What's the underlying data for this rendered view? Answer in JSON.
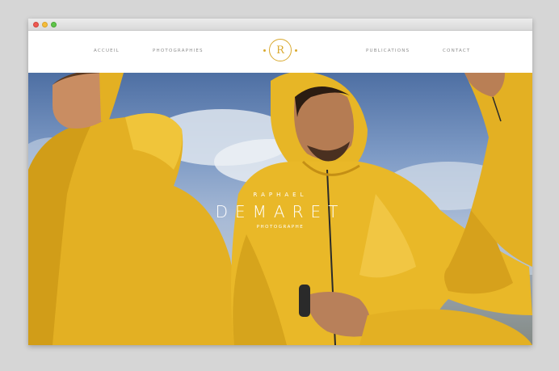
{
  "nav": {
    "items": [
      {
        "label": "ACCUEIL"
      },
      {
        "label": "PHOTOGRAPHIES"
      },
      {
        "label": "PUBLICATIONS"
      },
      {
        "label": "CONTACT"
      }
    ],
    "logo_letter": "R"
  },
  "hero": {
    "first_name": "RAPHAEL",
    "last_name": "DEMARET",
    "role": "PHOTOGRAPHE"
  },
  "colors": {
    "accent": "#d9a92e",
    "jacket_yellow": "#e7b626",
    "sky": "#7d9ac5"
  }
}
